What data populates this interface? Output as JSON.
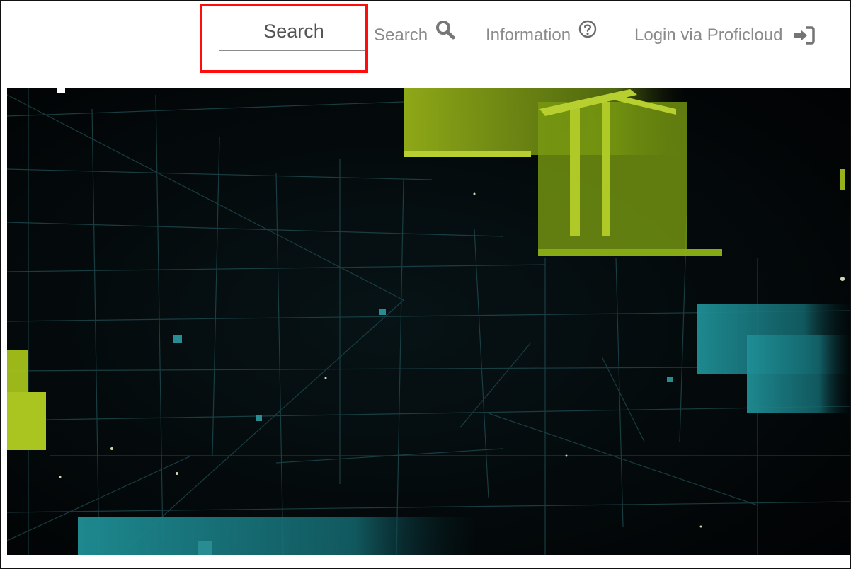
{
  "header": {
    "search_field": {
      "placeholder": "Search",
      "value": ""
    },
    "nav": {
      "search_label": "Search",
      "search_icon": "magnifier-icon",
      "information_label": "Information",
      "information_icon": "question-circle-icon",
      "login_label": "Login via Proficloud",
      "login_icon": "sign-in-icon"
    }
  },
  "colors": {
    "highlight": "#ff0d0d",
    "nav_text": "#8a8a8a",
    "hero_background": "#020405",
    "hero_green": "#a7c41a",
    "hero_teal": "#1f8f96"
  }
}
